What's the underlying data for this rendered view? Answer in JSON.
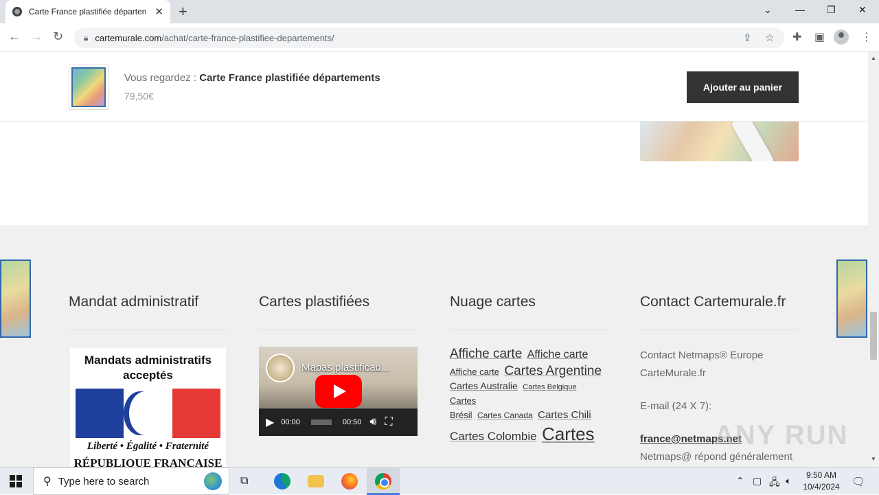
{
  "browser": {
    "tab_title": "Carte France plastifiée départem",
    "url_host": "cartemurale.com",
    "url_path": "/achat/carte-france-plastifiee-departements/"
  },
  "sticky_bar": {
    "prefix": "Vous regardez : ",
    "product_name": "Carte France plastifiée départements",
    "price": "79,50€",
    "add_to_cart": "Ajouter au panier"
  },
  "footer": {
    "col1_title": "Mandat administratif",
    "col2_title": "Cartes plastifiées",
    "col3_title": "Nuage cartes",
    "col4_title": "Contact Cartemurale.fr",
    "badge": {
      "line1": "Mandats administratifs",
      "line2": "acceptés",
      "motto": "Liberté • Égalité • Fraternité",
      "republic": "RÉPUBLIQUE FRANCAISE"
    },
    "video": {
      "title": "Mapas plastificad...",
      "current_time": "00:00",
      "duration": "00:50"
    },
    "tags": [
      {
        "label": "Affiche carte",
        "size": "19px"
      },
      {
        "label": "Affiche carte",
        "size": "16px"
      },
      {
        "label": "Affiche carte",
        "size": "13px"
      },
      {
        "label": "Cartes Argentine",
        "size": "19px"
      },
      {
        "label": "Cartes Australie",
        "size": "14px"
      },
      {
        "label": "Cartes Belgique",
        "size": "11px"
      },
      {
        "label": "Cartes",
        "size": "13px"
      },
      {
        "label": "Brésil",
        "size": "13px"
      },
      {
        "label": "Cartes Canada",
        "size": "12px"
      },
      {
        "label": "Cartes Chili",
        "size": "15px"
      },
      {
        "label": "Cartes Colombie",
        "size": "17px"
      },
      {
        "label": "Cartes",
        "size": "26px"
      }
    ],
    "contact": {
      "line1": "Contact Netmaps® Europe",
      "line2": "CarteMurale.fr",
      "email_label": "E-mail (24 X 7):",
      "email": "france@netmaps.net",
      "reply": "Netmaps@ répond généralement"
    }
  },
  "watermark": "ANY RUN",
  "taskbar": {
    "search_placeholder": "Type here to search",
    "time": "9:50 AM",
    "date": "10/4/2024"
  }
}
